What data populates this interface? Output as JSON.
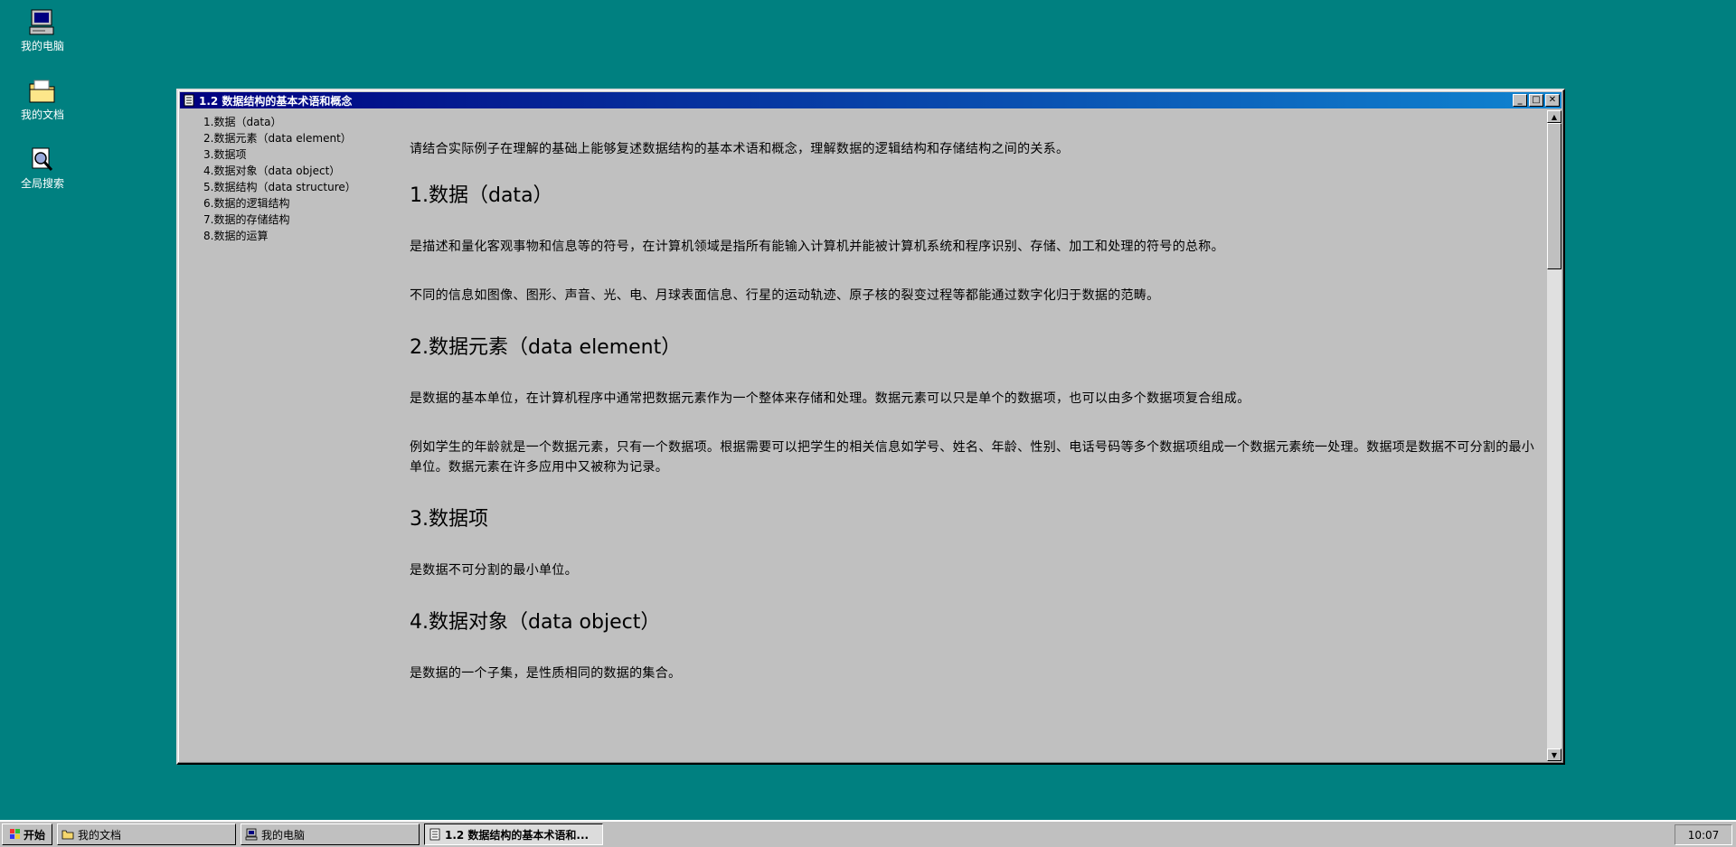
{
  "desktop": {
    "icons": [
      {
        "label": "我的电脑",
        "icon": "computer-icon"
      },
      {
        "label": "我的文档",
        "icon": "folder-icon"
      },
      {
        "label": "全局搜索",
        "icon": "search-icon"
      }
    ]
  },
  "window": {
    "title": "1.2 数据结构的基本术语和概念",
    "buttons": {
      "minimize": "_",
      "maximize": "□",
      "close": "✕"
    },
    "toc": [
      "1.数据（data）",
      "2.数据元素（data element）",
      "3.数据项",
      "4.数据对象（data object）",
      "5.数据结构（data structure）",
      "6.数据的逻辑结构",
      "7.数据的存储结构",
      "8.数据的运算"
    ],
    "article": {
      "intro": "请结合实际例子在理解的基础上能够复述数据结构的基本术语和概念，理解数据的逻辑结构和存储结构之间的关系。",
      "sections": [
        {
          "heading": "1.数据（data）",
          "paragraphs": [
            "是描述和量化客观事物和信息等的符号，在计算机领域是指所有能输入计算机并能被计算机系统和程序识别、存储、加工和处理的符号的总称。",
            "不同的信息如图像、图形、声音、光、电、月球表面信息、行星的运动轨迹、原子核的裂变过程等都能通过数字化归于数据的范畴。"
          ]
        },
        {
          "heading": "2.数据元素（data element）",
          "paragraphs": [
            "是数据的基本单位，在计算机程序中通常把数据元素作为一个整体来存储和处理。数据元素可以只是单个的数据项，也可以由多个数据项复合组成。",
            "例如学生的年龄就是一个数据元素，只有一个数据项。根据需要可以把学生的相关信息如学号、姓名、年龄、性别、电话号码等多个数据项组成一个数据元素统一处理。数据项是数据不可分割的最小单位。数据元素在许多应用中又被称为记录。"
          ]
        },
        {
          "heading": "3.数据项",
          "paragraphs": [
            "是数据不可分割的最小单位。"
          ]
        },
        {
          "heading": "4.数据对象（data object）",
          "paragraphs": [
            "是数据的一个子集，是性质相同的数据的集合。"
          ]
        }
      ]
    }
  },
  "taskbar": {
    "start_label": "开始",
    "tasks": [
      {
        "label": "我的文档",
        "icon": "folder-icon",
        "active": false
      },
      {
        "label": "我的电脑",
        "icon": "computer-icon",
        "active": false
      },
      {
        "label": "1.2 数据结构的基本术语和...",
        "icon": "document-icon",
        "active": true
      }
    ],
    "clock": "10:07"
  },
  "colors": {
    "desktop": "#008080",
    "titlebar_start": "#000080",
    "titlebar_end": "#1084d0",
    "window": "#c0c0c0"
  }
}
